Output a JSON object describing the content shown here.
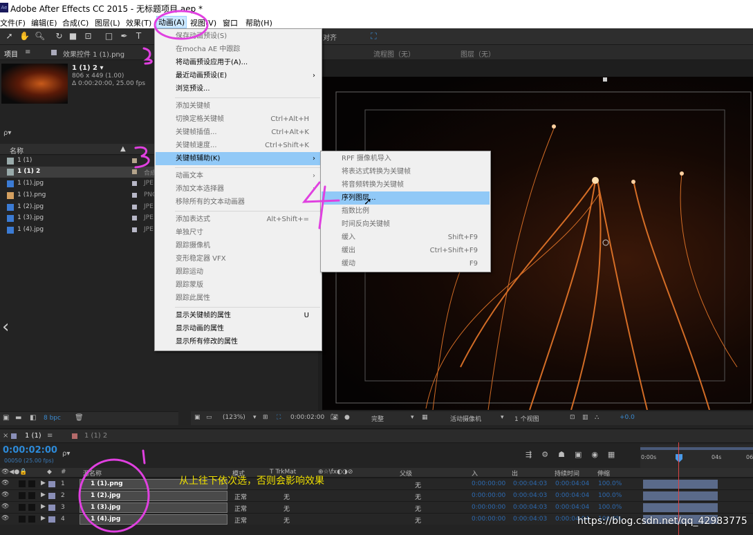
{
  "window": {
    "title": "Adobe After Effects CC 2015 - 无标题项目.aep *",
    "app_icon": "Ae"
  },
  "menubar": [
    "文件(F)",
    "编辑(E)",
    "合成(C)",
    "图层(L)",
    "效果(T)",
    "动画(A)",
    "视图(V)",
    "窗口",
    "帮助(H)"
  ],
  "toolbar": {
    "snap_label": "对齐"
  },
  "project_panel": {
    "tab_project": "项目",
    "tab_effects": "效果控件 1 (1).png",
    "comp_name": "1 (1) 2 ▾",
    "comp_size": "806 x 449 (1.00)",
    "comp_duration": "Δ 0:00:20:00, 25.00 fps",
    "search_placeholder": "ρ▾",
    "col_name": "名称",
    "bit_depth": "8 bpc",
    "items": [
      {
        "name": "1 (1)",
        "type": ""
      },
      {
        "name": "1 (1) 2",
        "type": "合成"
      },
      {
        "name": "1 (1).jpg",
        "type": "JPE"
      },
      {
        "name": "1 (1).png",
        "type": "PNG"
      },
      {
        "name": "1 (2).jpg",
        "type": "JPE"
      },
      {
        "name": "1 (3).jpg",
        "type": "JPE"
      },
      {
        "name": "1 (4).jpg",
        "type": "JPE"
      }
    ]
  },
  "viewer": {
    "tab_flow": "流程图（无）",
    "tab_layer": "图层（无）",
    "zoom": "(123%)",
    "timecode": "0:00:02:00",
    "quality": "完整",
    "camera": "活动摄像机",
    "views": "1 个视图",
    "exposure": "+0.0"
  },
  "anim_menu": {
    "items": [
      {
        "label": "保存动画预设(S)",
        "shortcut": "",
        "disabled": true
      },
      {
        "label": "在mocha AE 中跟踪",
        "shortcut": "",
        "disabled": true
      },
      {
        "label": "将动画预设应用于(A)...",
        "shortcut": "",
        "disabled": false
      },
      {
        "label": "最近动画预设(E)",
        "shortcut": "",
        "disabled": false,
        "submenu": true
      },
      {
        "label": "浏览预设...",
        "shortcut": "",
        "disabled": false
      },
      {
        "label": "添加关键帧",
        "shortcut": "",
        "disabled": true
      },
      {
        "label": "切换定格关键帧",
        "shortcut": "Ctrl+Alt+H",
        "disabled": true
      },
      {
        "label": "关键帧插值...",
        "shortcut": "Ctrl+Alt+K",
        "disabled": true
      },
      {
        "label": "关键帧速度...",
        "shortcut": "Ctrl+Shift+K",
        "disabled": true
      },
      {
        "label": "关键帧辅助(K)",
        "shortcut": "",
        "disabled": false,
        "submenu": true,
        "highlighted": true
      },
      {
        "label": "动画文本",
        "shortcut": "",
        "disabled": true,
        "submenu": true
      },
      {
        "label": "添加文本选择器",
        "shortcut": "",
        "disabled": true,
        "submenu": true
      },
      {
        "label": "移除所有的文本动画器",
        "shortcut": "",
        "disabled": true
      },
      {
        "label": "添加表达式",
        "shortcut": "Alt+Shift+=",
        "disabled": true
      },
      {
        "label": "单独尺寸",
        "shortcut": "",
        "disabled": true
      },
      {
        "label": "跟踪摄像机",
        "shortcut": "",
        "disabled": true
      },
      {
        "label": "变形稳定器 VFX",
        "shortcut": "",
        "disabled": true
      },
      {
        "label": "跟踪运动",
        "shortcut": "",
        "disabled": true
      },
      {
        "label": "跟踪蒙版",
        "shortcut": "",
        "disabled": true
      },
      {
        "label": "跟踪此属性",
        "shortcut": "",
        "disabled": true
      },
      {
        "label": "显示关键帧的属性",
        "shortcut": "U",
        "disabled": false
      },
      {
        "label": "显示动画的属性",
        "shortcut": "",
        "disabled": false
      },
      {
        "label": "显示所有修改的属性",
        "shortcut": "",
        "disabled": false
      }
    ]
  },
  "keyframe_submenu": {
    "items": [
      {
        "label": "RPF 摄像机导入",
        "shortcut": "",
        "disabled": true
      },
      {
        "label": "将表达式转换为关键帧",
        "shortcut": "",
        "disabled": true
      },
      {
        "label": "将音频转换为关键帧",
        "shortcut": "",
        "disabled": true
      },
      {
        "label": "序列图层...",
        "shortcut": "",
        "disabled": false,
        "highlighted": true
      },
      {
        "label": "指数比例",
        "shortcut": "",
        "disabled": true
      },
      {
        "label": "时间反向关键帧",
        "shortcut": "",
        "disabled": true
      },
      {
        "label": "缓入",
        "shortcut": "Shift+F9",
        "disabled": true
      },
      {
        "label": "缓出",
        "shortcut": "Ctrl+Shift+F9",
        "disabled": true
      },
      {
        "label": "缓动",
        "shortcut": "F9",
        "disabled": true
      }
    ]
  },
  "timeline": {
    "tab_active": "1 (1)",
    "tab_other": "1 (1) 2",
    "timecode": "0:00:02:00",
    "frame_info": "00050 (25.00 fps)",
    "search_placeholder": "ρ▾",
    "headers": {
      "num": "#",
      "name": "源名称",
      "mode": "模式",
      "trkmat": "T TrkMat",
      "parent": "父级",
      "in": "入",
      "out": "出",
      "duration": "持续时间",
      "stretch": "伸缩"
    },
    "ruler": [
      "0:00s",
      "04s",
      "06"
    ],
    "layers": [
      {
        "num": "1",
        "name": "1 (1).png",
        "mode": "",
        "trkmat": "",
        "parent": "无",
        "in": "0:00:00:00",
        "out": "0:00:04:03",
        "duration": "0:00:04:04",
        "stretch": "100.0%"
      },
      {
        "num": "2",
        "name": "1 (2).jpg",
        "mode": "正常",
        "trkmat": "无",
        "parent": "无",
        "in": "0:00:00:00",
        "out": "0:00:04:03",
        "duration": "0:00:04:04",
        "stretch": "100.0%"
      },
      {
        "num": "3",
        "name": "1 (3).jpg",
        "mode": "正常",
        "trkmat": "无",
        "parent": "无",
        "in": "0:00:00:00",
        "out": "0:00:04:03",
        "duration": "0:00:04:04",
        "stretch": "100.0%"
      },
      {
        "num": "4",
        "name": "1 (4).jpg",
        "mode": "正常",
        "trkmat": "无",
        "parent": "无",
        "in": "0:00:00:00",
        "out": "0:00:04:03",
        "duration": "0:00:04:04",
        "stretch": "100.0%"
      }
    ]
  },
  "annotations": {
    "n1": "1",
    "n2": "2",
    "n3": "3",
    "n4": "4",
    "caption": "从上往下依次选，否则会影响效果"
  },
  "watermark": "https://blog.csdn.net/qq_42983775",
  "colors": {
    "menu_highlight": "#91c9f7",
    "annotation": "#e040e0",
    "caption": "#f0e000",
    "timecode": "#2d6ab0"
  }
}
